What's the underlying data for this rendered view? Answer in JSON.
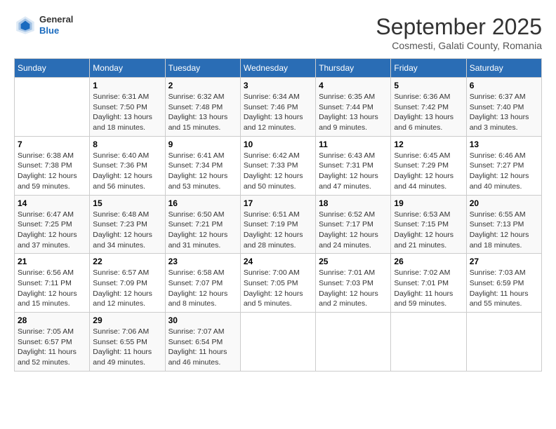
{
  "header": {
    "logo_general": "General",
    "logo_blue": "Blue",
    "month": "September 2025",
    "location": "Cosmesti, Galati County, Romania"
  },
  "days_of_week": [
    "Sunday",
    "Monday",
    "Tuesday",
    "Wednesday",
    "Thursday",
    "Friday",
    "Saturday"
  ],
  "weeks": [
    [
      {
        "day": "",
        "info": ""
      },
      {
        "day": "1",
        "info": "Sunrise: 6:31 AM\nSunset: 7:50 PM\nDaylight: 13 hours\nand 18 minutes."
      },
      {
        "day": "2",
        "info": "Sunrise: 6:32 AM\nSunset: 7:48 PM\nDaylight: 13 hours\nand 15 minutes."
      },
      {
        "day": "3",
        "info": "Sunrise: 6:34 AM\nSunset: 7:46 PM\nDaylight: 13 hours\nand 12 minutes."
      },
      {
        "day": "4",
        "info": "Sunrise: 6:35 AM\nSunset: 7:44 PM\nDaylight: 13 hours\nand 9 minutes."
      },
      {
        "day": "5",
        "info": "Sunrise: 6:36 AM\nSunset: 7:42 PM\nDaylight: 13 hours\nand 6 minutes."
      },
      {
        "day": "6",
        "info": "Sunrise: 6:37 AM\nSunset: 7:40 PM\nDaylight: 13 hours\nand 3 minutes."
      }
    ],
    [
      {
        "day": "7",
        "info": "Sunrise: 6:38 AM\nSunset: 7:38 PM\nDaylight: 12 hours\nand 59 minutes."
      },
      {
        "day": "8",
        "info": "Sunrise: 6:40 AM\nSunset: 7:36 PM\nDaylight: 12 hours\nand 56 minutes."
      },
      {
        "day": "9",
        "info": "Sunrise: 6:41 AM\nSunset: 7:34 PM\nDaylight: 12 hours\nand 53 minutes."
      },
      {
        "day": "10",
        "info": "Sunrise: 6:42 AM\nSunset: 7:33 PM\nDaylight: 12 hours\nand 50 minutes."
      },
      {
        "day": "11",
        "info": "Sunrise: 6:43 AM\nSunset: 7:31 PM\nDaylight: 12 hours\nand 47 minutes."
      },
      {
        "day": "12",
        "info": "Sunrise: 6:45 AM\nSunset: 7:29 PM\nDaylight: 12 hours\nand 44 minutes."
      },
      {
        "day": "13",
        "info": "Sunrise: 6:46 AM\nSunset: 7:27 PM\nDaylight: 12 hours\nand 40 minutes."
      }
    ],
    [
      {
        "day": "14",
        "info": "Sunrise: 6:47 AM\nSunset: 7:25 PM\nDaylight: 12 hours\nand 37 minutes."
      },
      {
        "day": "15",
        "info": "Sunrise: 6:48 AM\nSunset: 7:23 PM\nDaylight: 12 hours\nand 34 minutes."
      },
      {
        "day": "16",
        "info": "Sunrise: 6:50 AM\nSunset: 7:21 PM\nDaylight: 12 hours\nand 31 minutes."
      },
      {
        "day": "17",
        "info": "Sunrise: 6:51 AM\nSunset: 7:19 PM\nDaylight: 12 hours\nand 28 minutes."
      },
      {
        "day": "18",
        "info": "Sunrise: 6:52 AM\nSunset: 7:17 PM\nDaylight: 12 hours\nand 24 minutes."
      },
      {
        "day": "19",
        "info": "Sunrise: 6:53 AM\nSunset: 7:15 PM\nDaylight: 12 hours\nand 21 minutes."
      },
      {
        "day": "20",
        "info": "Sunrise: 6:55 AM\nSunset: 7:13 PM\nDaylight: 12 hours\nand 18 minutes."
      }
    ],
    [
      {
        "day": "21",
        "info": "Sunrise: 6:56 AM\nSunset: 7:11 PM\nDaylight: 12 hours\nand 15 minutes."
      },
      {
        "day": "22",
        "info": "Sunrise: 6:57 AM\nSunset: 7:09 PM\nDaylight: 12 hours\nand 12 minutes."
      },
      {
        "day": "23",
        "info": "Sunrise: 6:58 AM\nSunset: 7:07 PM\nDaylight: 12 hours\nand 8 minutes."
      },
      {
        "day": "24",
        "info": "Sunrise: 7:00 AM\nSunset: 7:05 PM\nDaylight: 12 hours\nand 5 minutes."
      },
      {
        "day": "25",
        "info": "Sunrise: 7:01 AM\nSunset: 7:03 PM\nDaylight: 12 hours\nand 2 minutes."
      },
      {
        "day": "26",
        "info": "Sunrise: 7:02 AM\nSunset: 7:01 PM\nDaylight: 11 hours\nand 59 minutes."
      },
      {
        "day": "27",
        "info": "Sunrise: 7:03 AM\nSunset: 6:59 PM\nDaylight: 11 hours\nand 55 minutes."
      }
    ],
    [
      {
        "day": "28",
        "info": "Sunrise: 7:05 AM\nSunset: 6:57 PM\nDaylight: 11 hours\nand 52 minutes."
      },
      {
        "day": "29",
        "info": "Sunrise: 7:06 AM\nSunset: 6:55 PM\nDaylight: 11 hours\nand 49 minutes."
      },
      {
        "day": "30",
        "info": "Sunrise: 7:07 AM\nSunset: 6:54 PM\nDaylight: 11 hours\nand 46 minutes."
      },
      {
        "day": "",
        "info": ""
      },
      {
        "day": "",
        "info": ""
      },
      {
        "day": "",
        "info": ""
      },
      {
        "day": "",
        "info": ""
      }
    ]
  ]
}
